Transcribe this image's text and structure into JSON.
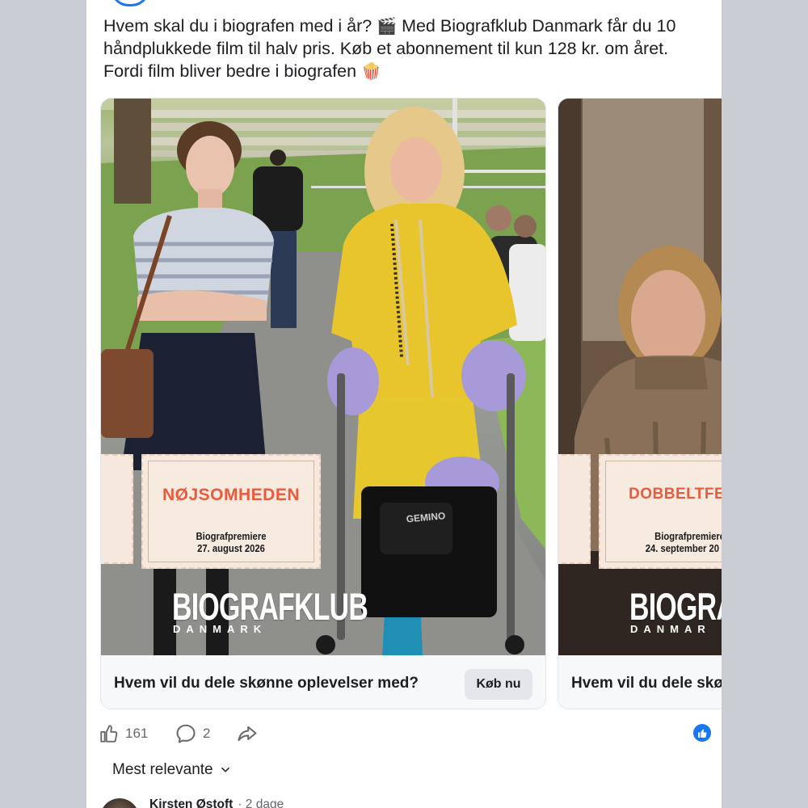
{
  "post": {
    "text_part1": "Hvem skal du i biografen med i år? ",
    "text_part2": " Med Biografklub Danmark får du 10 håndplukkede film til halv pris. Køb et abonnement til kun 128 kr. om året. Fordi film bliver bedre i biografen ",
    "emoji_clapper": "🎬",
    "emoji_popcorn": "🍿"
  },
  "carousel": {
    "cards": [
      {
        "film_title": "NØJSOMHEDEN",
        "premiere_label": "Biografpremiere",
        "premiere_date": "27. august 2026",
        "brand": "BIOGRAFKLUB",
        "brand_sub": "DANMARK",
        "footer_text": "Hvem vil du dele skønne oplevelser med?",
        "button_label": "Køb nu"
      },
      {
        "film_title": "DOBBELTFE",
        "premiere_label": "Biografpremiere",
        "premiere_date": "24. september 20",
        "brand": "BIOGRAFKL",
        "brand_sub": "DANMAR",
        "footer_text": "Hvem vil du dele skø"
      }
    ]
  },
  "actions": {
    "like_count": "161",
    "comment_count": "2",
    "like_icon": "thumbs-up-icon",
    "comment_icon": "comment-bubble-icon",
    "share_icon": "share-arrow-icon",
    "reaction_icon": "like-reaction-icon"
  },
  "comments": {
    "sort_label": "Mest relevante",
    "first": {
      "author": "Kirsten Østoft",
      "meta": "· 2 dage"
    }
  },
  "colors": {
    "accent": "#1877f2",
    "ticket_title": "#ea5a3f",
    "ticket_bg": "#f6e8dc"
  }
}
